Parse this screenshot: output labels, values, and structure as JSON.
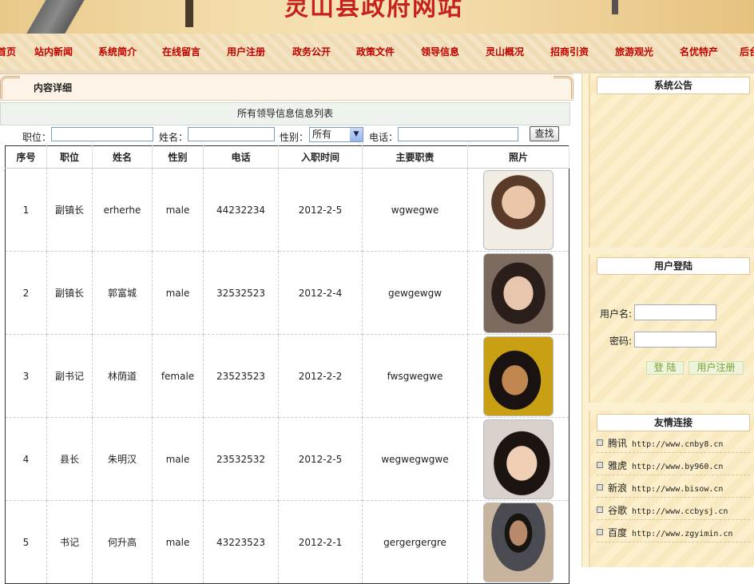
{
  "site": {
    "title": "灵山县政府网站"
  },
  "nav": [
    "首页",
    "站内新闻",
    "系统简介",
    "在线留言",
    "用户注册",
    "政务公开",
    "政策文件",
    "领导信息",
    "灵山概况",
    "招商引资",
    "旅游观光",
    "名优特产",
    "后台"
  ],
  "content": {
    "header": "内容详细",
    "list_caption": "所有领导信息信息列表"
  },
  "search": {
    "position_label": "职位：",
    "name_label": "姓名：",
    "gender_label": "性别：",
    "gender_selected": "所有",
    "phone_label": "电话：",
    "button": "查找"
  },
  "table": {
    "headers": [
      "序号",
      "职位",
      "姓名",
      "性别",
      "电话",
      "入职时间",
      "主要职责",
      "照片"
    ],
    "rows": [
      {
        "no": "1",
        "position": "副镇长",
        "name": "erherhe",
        "gender": "male",
        "phone": "44232234",
        "date": "2012-2-5",
        "duty": "wgwegwe"
      },
      {
        "no": "2",
        "position": "副镇长",
        "name": "郭富城",
        "gender": "male",
        "phone": "32532523",
        "date": "2012-2-4",
        "duty": "gewgewgw"
      },
      {
        "no": "3",
        "position": "副书记",
        "name": "林荫道",
        "gender": "female",
        "phone": "23523523",
        "date": "2012-2-2",
        "duty": "fwsgwegwe"
      },
      {
        "no": "4",
        "position": "县长",
        "name": "朱明汉",
        "gender": "male",
        "phone": "23532532",
        "date": "2012-2-5",
        "duty": "wegwegwgwe"
      },
      {
        "no": "5",
        "position": "书记",
        "name": "何升高",
        "gender": "male",
        "phone": "43223523",
        "date": "2012-2-1",
        "duty": "gergergergre"
      }
    ]
  },
  "sidebar": {
    "notice_title": "系统公告",
    "login_title": "用户登陆",
    "username_label": "用户名:",
    "password_label": "密码:",
    "login_button": "登 陆",
    "register_button": "用户注册",
    "links_title": "友情连接",
    "links": [
      {
        "name": "腾讯",
        "url": "http://www.cnby8.cn"
      },
      {
        "name": "雅虎",
        "url": "http://www.by960.cn"
      },
      {
        "name": "新浪",
        "url": "http://www.bisow.cn"
      },
      {
        "name": "谷歌",
        "url": "http://www.ccbysj.cn"
      },
      {
        "name": "百度",
        "url": "http://www.zgyimin.cn"
      }
    ]
  },
  "colors": {
    "nav_text": "#c00000",
    "title_red": "#c8201a",
    "sidebar_bg": "#fbf0cf"
  }
}
